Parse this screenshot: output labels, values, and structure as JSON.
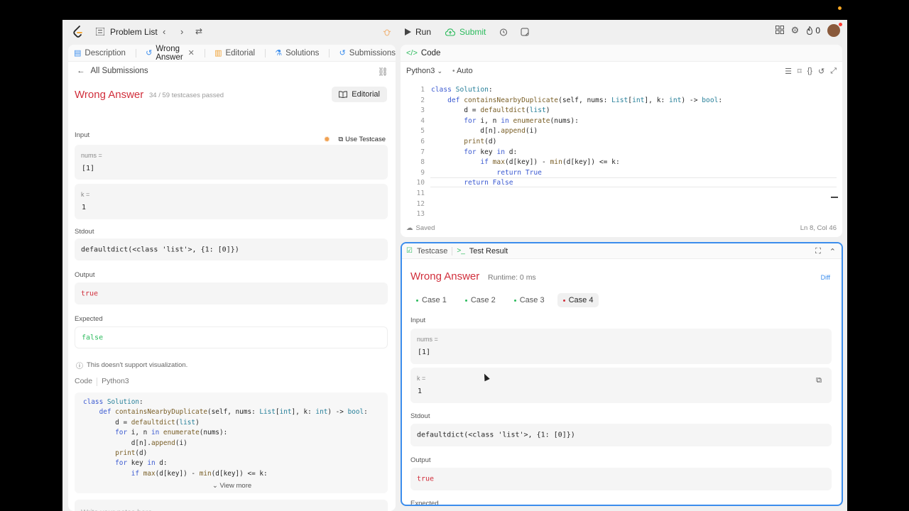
{
  "topbar": {
    "problem_list_label": "Problem List",
    "run_label": "Run",
    "submit_label": "Submit",
    "streak_count": "0"
  },
  "left": {
    "tabs": [
      {
        "label": "Description",
        "icon": "description-icon"
      },
      {
        "label": "Wrong Answer",
        "icon": "history-icon"
      },
      {
        "label": "Editorial",
        "icon": "book-icon"
      },
      {
        "label": "Solutions",
        "icon": "flask-icon"
      },
      {
        "label": "Submissions",
        "icon": "history-icon"
      }
    ],
    "all_submissions": "All Submissions",
    "status": "Wrong Answer",
    "testcases_passed": "34 / 59 testcases passed",
    "editorial_button": "Editorial",
    "input_label": "Input",
    "use_testcase": "Use Testcase",
    "inputs": [
      {
        "name": "nums =",
        "value": "[1]"
      },
      {
        "name": "k =",
        "value": "1"
      }
    ],
    "stdout_label": "Stdout",
    "stdout_value": "defaultdict(<class 'list'>, {1: [0]})",
    "output_label": "Output",
    "output_value": "true",
    "expected_label": "Expected",
    "expected_value": "false",
    "viz_note": "This doesn't support visualization.",
    "code_label": "Code",
    "code_lang": "Python3",
    "view_more": "View more",
    "notes_placeholder": "Write your notes here"
  },
  "code_panel": {
    "title": "Code",
    "language": "Python3",
    "mode": "Auto",
    "saved": "Saved",
    "cursor_position": "Ln 8, Col 46"
  },
  "result_panel": {
    "tab_testcase": "Testcase",
    "tab_result": "Test Result",
    "status": "Wrong Answer",
    "runtime": "Runtime: 0 ms",
    "diff": "Diff",
    "cases": [
      "Case 1",
      "Case 2",
      "Case 3",
      "Case 4"
    ],
    "active_case": "Case 4",
    "input_label": "Input",
    "inputs": [
      {
        "name": "nums =",
        "value": "[1]"
      },
      {
        "name": "k =",
        "value": "1"
      }
    ],
    "stdout_label": "Stdout",
    "stdout_value": "defaultdict(<class 'list'>, {1: [0]})",
    "output_label": "Output",
    "output_value": "true",
    "expected_label": "Expected"
  },
  "colors": {
    "wrong": "#d12f3c",
    "accent_green": "#2cbb5d",
    "focus_blue": "#3b8ded"
  }
}
